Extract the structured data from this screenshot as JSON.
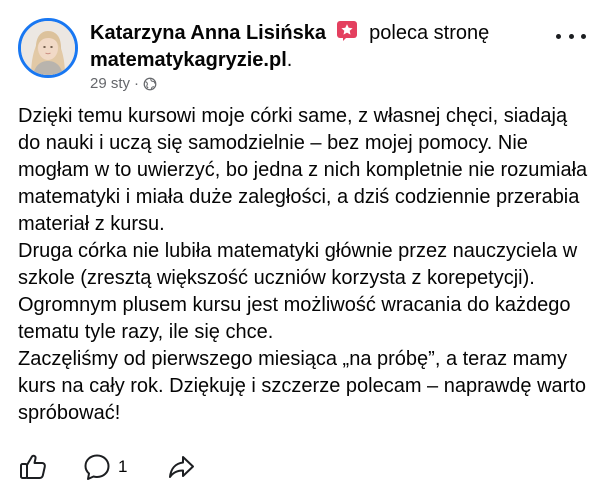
{
  "post": {
    "author": "Katarzyna Anna Lisińska",
    "action_text": "poleca stronę",
    "page_name": "matematykagryzie.pl",
    "page_suffix": ".",
    "date": "29 sty",
    "separator": "·",
    "audience_icon": "globe-icon",
    "badge_icon": "recommend-star-icon",
    "badge_color": "#e4405f",
    "paragraphs": [
      "Dzięki temu kursowi moje córki same, z własnej chęci, siadają do nauki i uczą się samodzielnie – bez mojej pomocy. Nie mogłam w to uwierzyć, bo jedna z nich kompletnie nie rozumiała matematyki i miała duże zaległości, a dziś codziennie przerabia materiał z kursu.",
      "Druga córka nie lubiła matematyki głównie przez nauczyciela w szkole (zresztą większość uczniów korzysta z korepetycji).",
      "Ogromnym plusem kursu jest możliwość wracania do każdego tematu tyle razy, ile się chce.",
      "Zaczęliśmy od pierwszego miesiąca „na próbę”, a teraz mamy kurs na cały rok. Dziękuję i szczerze polecam – naprawdę warto spróbować!"
    ]
  },
  "actions": {
    "like_icon": "thumbs-up-icon",
    "comment_icon": "comment-icon",
    "comment_count": "1",
    "share_icon": "share-icon",
    "more_icon": "more-options-icon"
  },
  "colors": {
    "text": "#050505",
    "secondary_text": "#65676b",
    "avatar_ring": "#1877f2"
  }
}
